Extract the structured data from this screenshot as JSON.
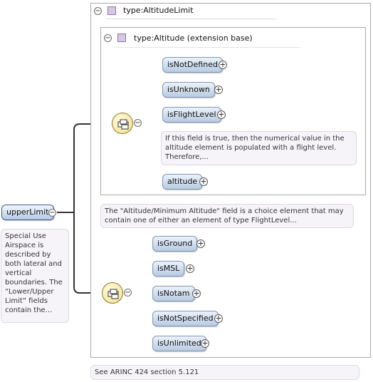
{
  "root": {
    "label": "upperLimit",
    "note": "Special Use Airspace is described by both lateral and vertical boundaries. The “Lower/Upper Limit” fields contain the..."
  },
  "outer_type": {
    "title": "type:AltitudeLimit",
    "collapse_glyph": "−"
  },
  "base_type": {
    "title": "type:Altitude (extension base)",
    "collapse_glyph": "−"
  },
  "choice_one": {
    "icon": "choice-compositor-icon",
    "elements": [
      {
        "label": "isNotDefined"
      },
      {
        "label": "isUnknown"
      },
      {
        "label": "isFlightLevel"
      },
      {
        "label": "altitude"
      }
    ],
    "flightlevel_note": "If this field is true, then the numerical value in the altitude element is populated with a flight level. Therefore,..."
  },
  "choice_note": "The \"Altitude/Minimum Altitude\" field is a choice element that may contain one of either an element of type FlightLevel...",
  "choice_two": {
    "icon": "choice-compositor-icon",
    "elements": [
      {
        "label": "isGround"
      },
      {
        "label": "isMSL"
      },
      {
        "label": "isNotam"
      },
      {
        "label": "isNotSpecified"
      },
      {
        "label": "isUnlimited"
      }
    ]
  },
  "footer_note": "See ARINC 424 section 5.121",
  "glyphs": {
    "plus": "+",
    "minus": "−"
  },
  "colors": {
    "element_fill_top": "#ecf2fa",
    "element_fill_bottom": "#b8cbe3",
    "choice_fill": "#f2e089",
    "type_icon": "#d7c6e4",
    "note_bg": "#f6f4f9"
  }
}
